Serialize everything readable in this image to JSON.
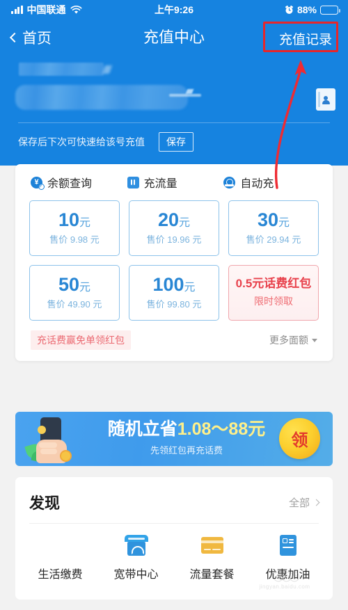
{
  "status_bar": {
    "carrier": "中国联通",
    "signal_icon": "signal-bars-icon",
    "wifi_icon": "wifi-icon",
    "time": "上午9:26",
    "alarm_icon": "alarm-clock-icon",
    "battery_percent": "88%",
    "battery_level": 88
  },
  "nav": {
    "back_label": "首页",
    "back_icon": "chevron-left-icon",
    "title": "充值中心",
    "action_label": "充值记录"
  },
  "account": {
    "name_redacted": true,
    "number_redacted": true,
    "contact_icon": "contact-book-icon",
    "save_hint": "保存后下次可快速给该号充值",
    "save_button": "保存"
  },
  "tabs": [
    {
      "label": "余额查询",
      "icon": "balance-query-icon",
      "symbol": "¥"
    },
    {
      "label": "充流量",
      "icon": "data-flow-icon"
    },
    {
      "label": "自动充",
      "icon": "auto-recharge-icon"
    }
  ],
  "denominations": [
    {
      "amount": "10",
      "unit": "元",
      "price": "售价 9.98 元",
      "type": "normal"
    },
    {
      "amount": "20",
      "unit": "元",
      "price": "售价 19.96 元",
      "type": "normal"
    },
    {
      "amount": "30",
      "unit": "元",
      "price": "售价 29.94 元",
      "type": "normal"
    },
    {
      "amount": "50",
      "unit": "元",
      "price": "售价 49.90 元",
      "type": "normal"
    },
    {
      "amount": "100",
      "unit": "元",
      "price": "售价 99.80 元",
      "type": "normal"
    },
    {
      "title": "0.5元话费红包",
      "sub": "限时领取",
      "type": "promo"
    }
  ],
  "card_footer": {
    "promo_tag": "充话费赢免单领红包",
    "more_label": "更多面额",
    "more_icon": "caret-down-icon"
  },
  "banner": {
    "main_prefix": "随机立省",
    "main_highlight": "1.08～88元",
    "sub": "先领红包再充话费",
    "coin_button": "领",
    "art_icon": "hand-holding-phone-icon"
  },
  "discover": {
    "title": "发现",
    "all_label": "全部",
    "all_icon": "chevron-right-icon",
    "items": [
      {
        "label": "生活缴费",
        "icon": "water-drop-bolt-icon"
      },
      {
        "label": "宽带中心",
        "icon": "storefront-wifi-icon"
      },
      {
        "label": "流量套餐",
        "icon": "credit-card-icon"
      },
      {
        "label": "优惠加油",
        "icon": "id-document-icon"
      }
    ]
  },
  "annotation": {
    "box_target": "充值记录",
    "color": "#e8262a",
    "arrow_from": "自动充",
    "arrow_to": "充值记录"
  },
  "theme": {
    "primary_blue": "#1683e0",
    "accent_blue": "#2886d4",
    "promo_red": "#e8414c",
    "annotation_red": "#e8262a",
    "coin_yellow": "#fcd02f"
  },
  "watermark": {
    "rings": "◎◎◎",
    "text": "jingyan.baidu.com"
  }
}
